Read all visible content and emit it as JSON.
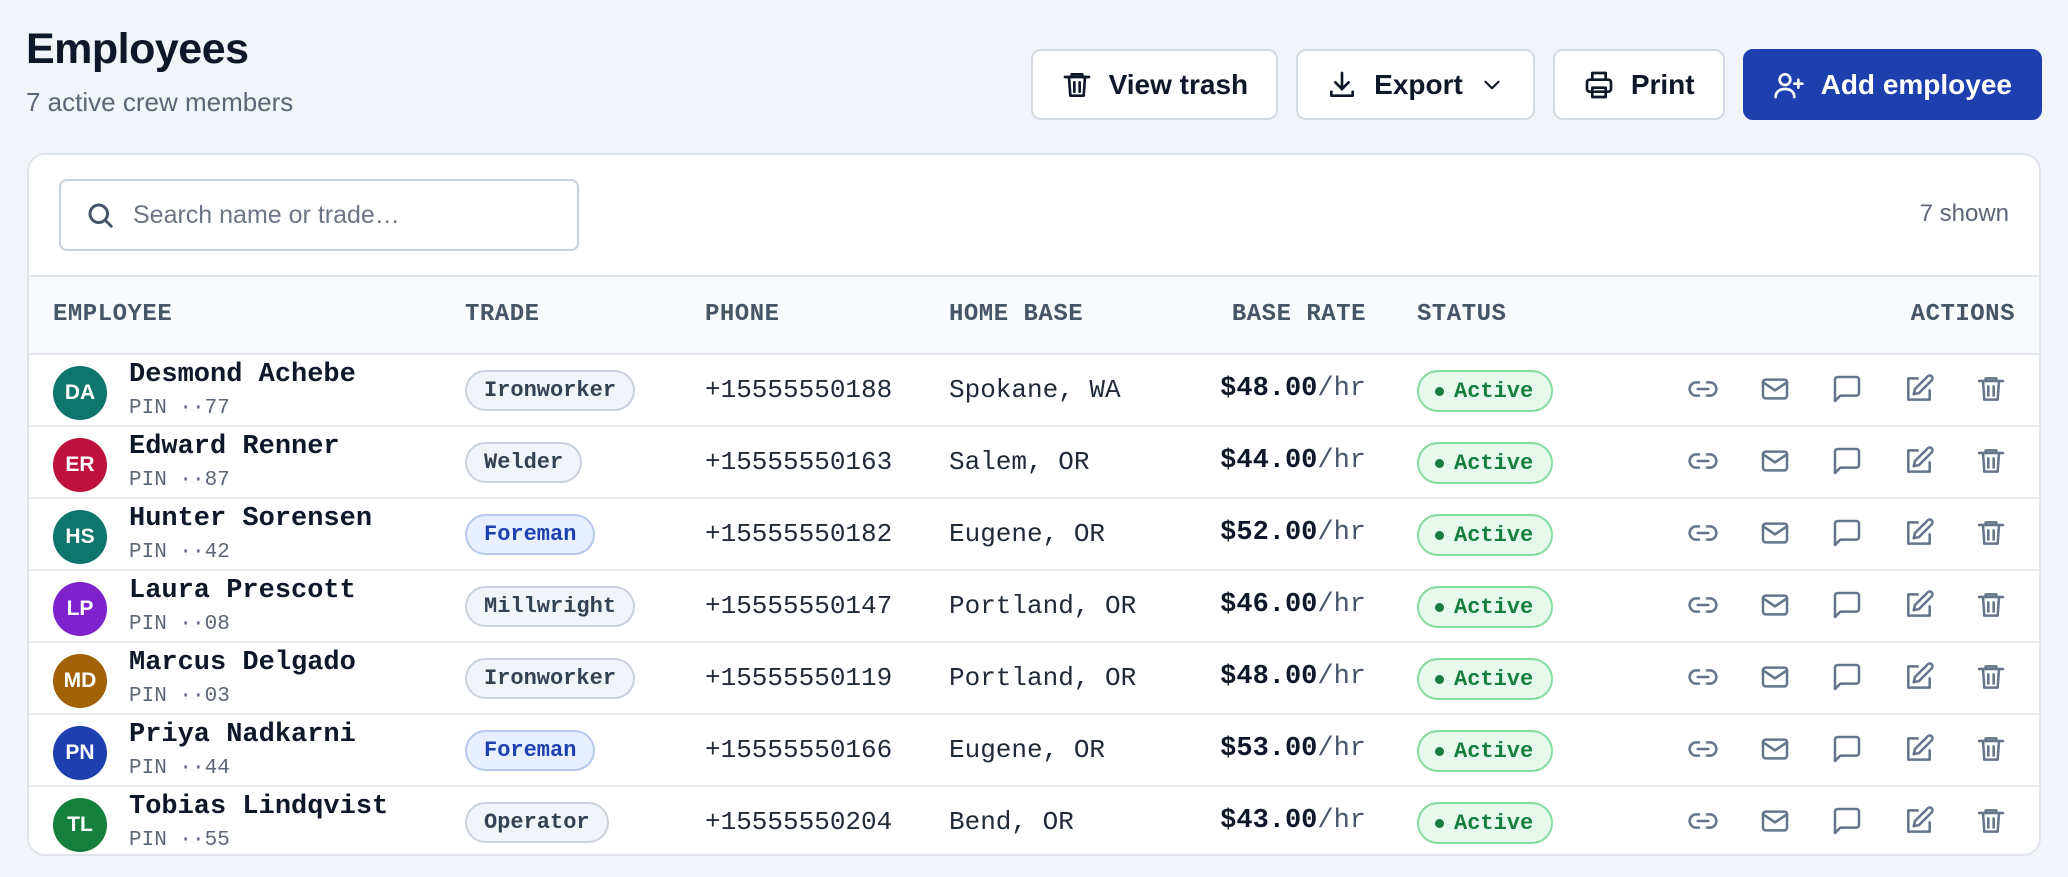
{
  "header": {
    "title": "Employees",
    "subtitle": "7 active crew members"
  },
  "toolbar": {
    "view_trash_label": "View trash",
    "export_label": "Export",
    "print_label": "Print",
    "add_label": "Add employee"
  },
  "search": {
    "placeholder": "Search name or trade…",
    "value": "",
    "count": "7 shown"
  },
  "table": {
    "columns": {
      "employee": "EMPLOYEE",
      "trade": "TRADE",
      "phone": "PHONE",
      "home_base": "HOME BASE",
      "base_rate": "BASE RATE",
      "status": "STATUS",
      "actions": "ACTIONS"
    },
    "rows": [
      {
        "initials": "DA",
        "avatar_color": "#0f766e",
        "name": "Desmond Achebe",
        "pin": "PIN ··77",
        "trade": "Ironworker",
        "trade_style": "gray",
        "phone": "+15555550188",
        "home_base": "Spokane, WA",
        "rate": "$48.00",
        "rate_unit": "/hr",
        "status": "Active"
      },
      {
        "initials": "ER",
        "avatar_color": "#be123c",
        "name": "Edward Renner",
        "pin": "PIN ··87",
        "trade": "Welder",
        "trade_style": "gray",
        "phone": "+15555550163",
        "home_base": "Salem, OR",
        "rate": "$44.00",
        "rate_unit": "/hr",
        "status": "Active"
      },
      {
        "initials": "HS",
        "avatar_color": "#0f766e",
        "name": "Hunter Sorensen",
        "pin": "PIN ··42",
        "trade": "Foreman",
        "trade_style": "blue",
        "phone": "+15555550182",
        "home_base": "Eugene, OR",
        "rate": "$52.00",
        "rate_unit": "/hr",
        "status": "Active"
      },
      {
        "initials": "LP",
        "avatar_color": "#7e22ce",
        "name": "Laura Prescott",
        "pin": "PIN ··08",
        "trade": "Millwright",
        "trade_style": "gray",
        "phone": "+15555550147",
        "home_base": "Portland, OR",
        "rate": "$46.00",
        "rate_unit": "/hr",
        "status": "Active"
      },
      {
        "initials": "MD",
        "avatar_color": "#a16207",
        "name": "Marcus Delgado",
        "pin": "PIN ··03",
        "trade": "Ironworker",
        "trade_style": "gray",
        "phone": "+15555550119",
        "home_base": "Portland, OR",
        "rate": "$48.00",
        "rate_unit": "/hr",
        "status": "Active"
      },
      {
        "initials": "PN",
        "avatar_color": "#1e40af",
        "name": "Priya Nadkarni",
        "pin": "PIN ··44",
        "trade": "Foreman",
        "trade_style": "blue",
        "phone": "+15555550166",
        "home_base": "Eugene, OR",
        "rate": "$53.00",
        "rate_unit": "/hr",
        "status": "Active"
      },
      {
        "initials": "TL",
        "avatar_color": "#15803d",
        "name": "Tobias Lindqvist",
        "pin": "PIN ··55",
        "trade": "Operator",
        "trade_style": "gray",
        "phone": "+15555550204",
        "home_base": "Bend, OR",
        "rate": "$43.00",
        "rate_unit": "/hr",
        "status": "Active"
      }
    ],
    "row_action_icons": [
      "link-icon",
      "mail-icon",
      "message-icon",
      "edit-icon",
      "trash-icon"
    ]
  },
  "colors": {
    "primary": "#1e40af",
    "status_active": "#15803d",
    "background": "#f1f4f8"
  }
}
